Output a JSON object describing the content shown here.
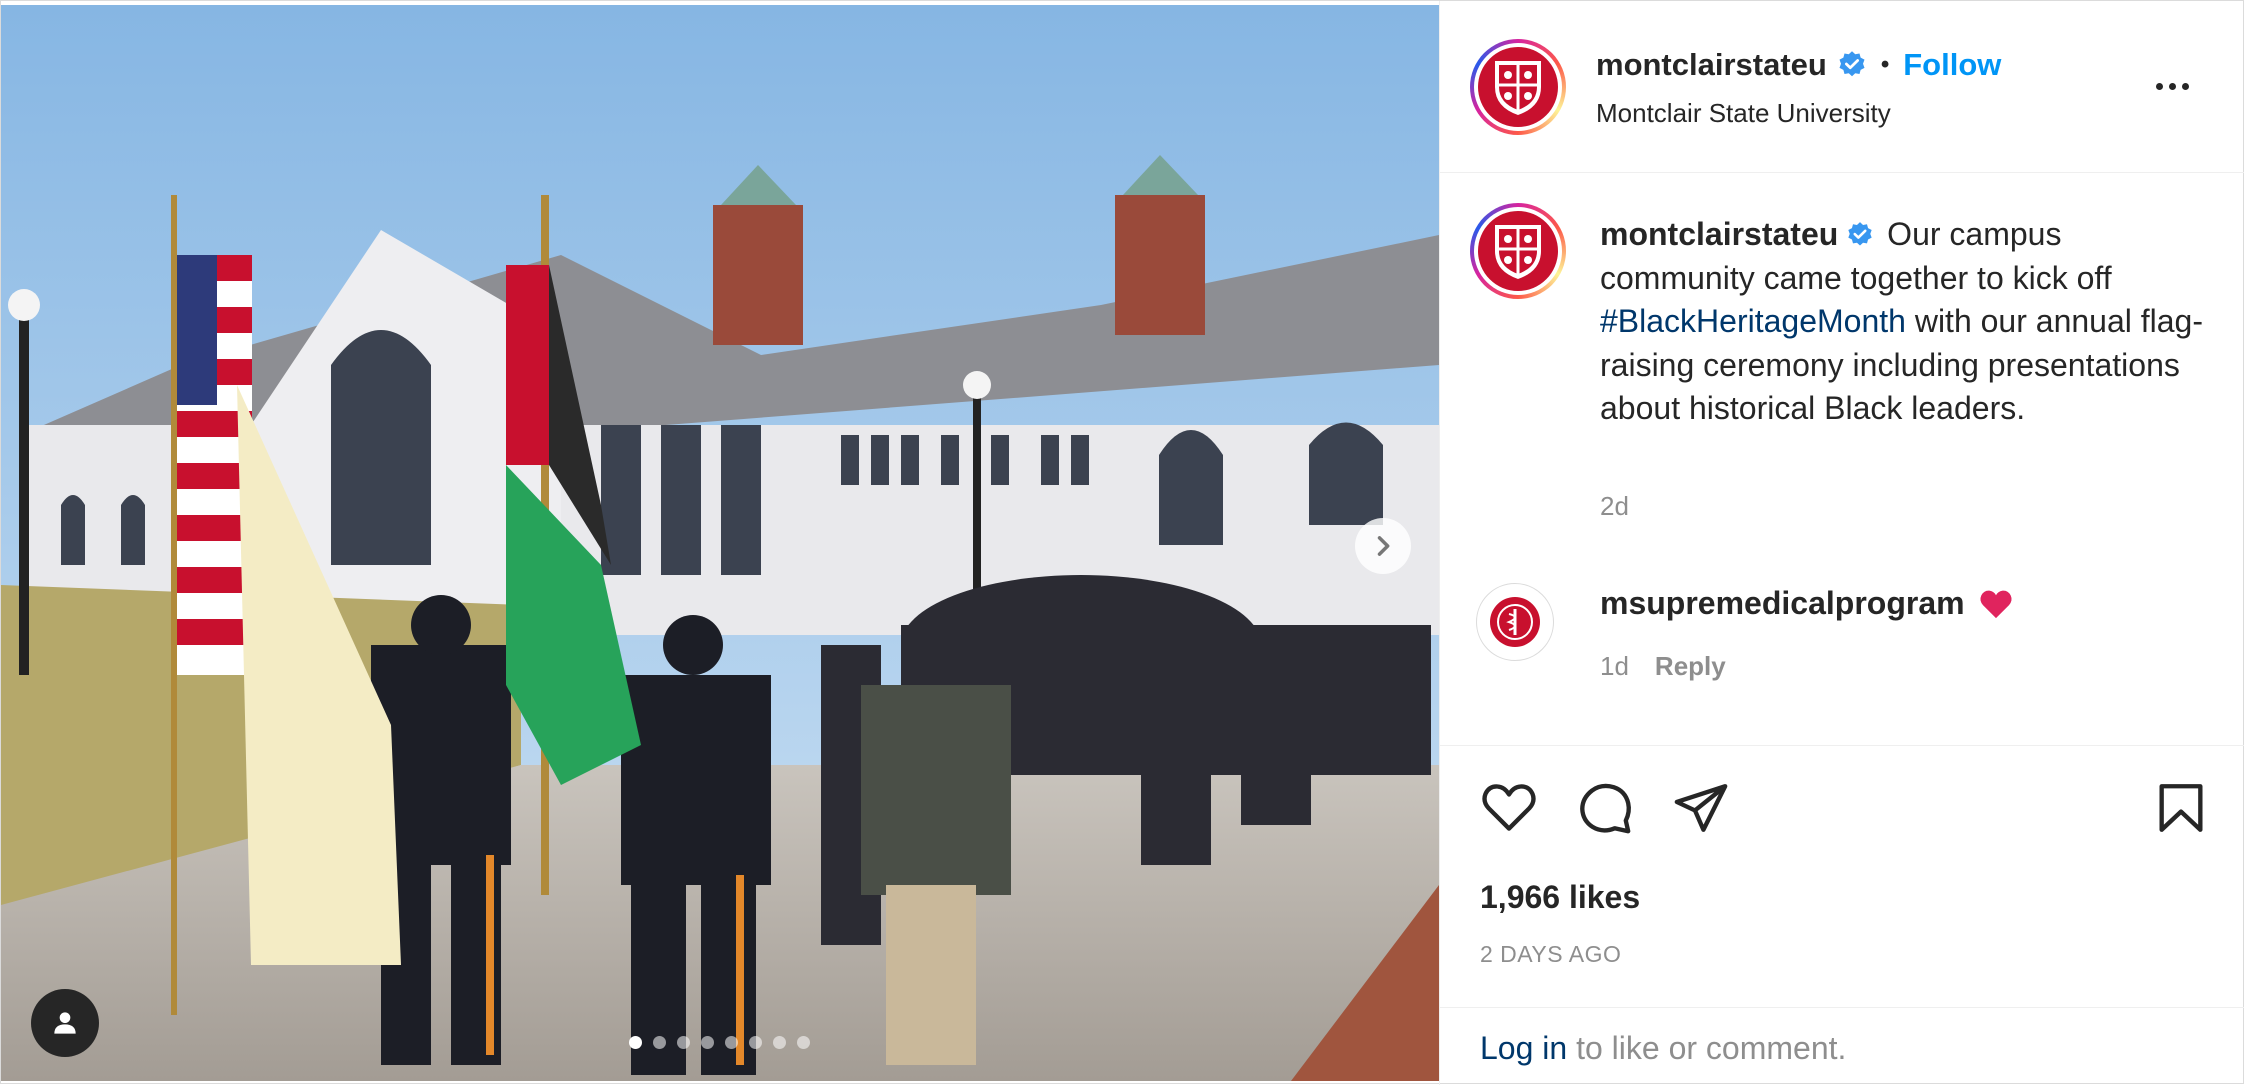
{
  "header": {
    "username": "montclairstateu",
    "separator": "•",
    "follow_label": "Follow",
    "subtitle": "Montclair State University"
  },
  "caption": {
    "username": "montclairstateu",
    "text_before": " Our campus community came together to kick off ",
    "hashtag": "#BlackHeritageMonth",
    "text_after": " with our annual flag-raising ceremony including presentations about historical Black leaders.",
    "time": "2d"
  },
  "comment": {
    "username": "msupremedicalprogram",
    "time": "1d",
    "reply_label": "Reply"
  },
  "likes": "1,966 likes",
  "date": "2 DAYS AGO",
  "login": {
    "link": "Log in",
    "text": " to like or comment."
  },
  "carousel": {
    "total_slides": 8,
    "active_index": 0
  },
  "icons": {
    "verified": "verified-badge-icon",
    "more": "more-options-icon",
    "like": "heart-outline-icon",
    "comment": "comment-bubble-icon",
    "share": "paper-plane-icon",
    "save": "bookmark-icon",
    "next": "chevron-right-icon",
    "tag": "user-tag-icon"
  },
  "colors": {
    "follow_blue": "#0095f6",
    "hashtag_link": "#00376b",
    "verified_blue": "#3897f0",
    "muted_text": "#8e8e8e",
    "emoji_heart": "#e0245e",
    "brand_red": "#c8102e"
  }
}
